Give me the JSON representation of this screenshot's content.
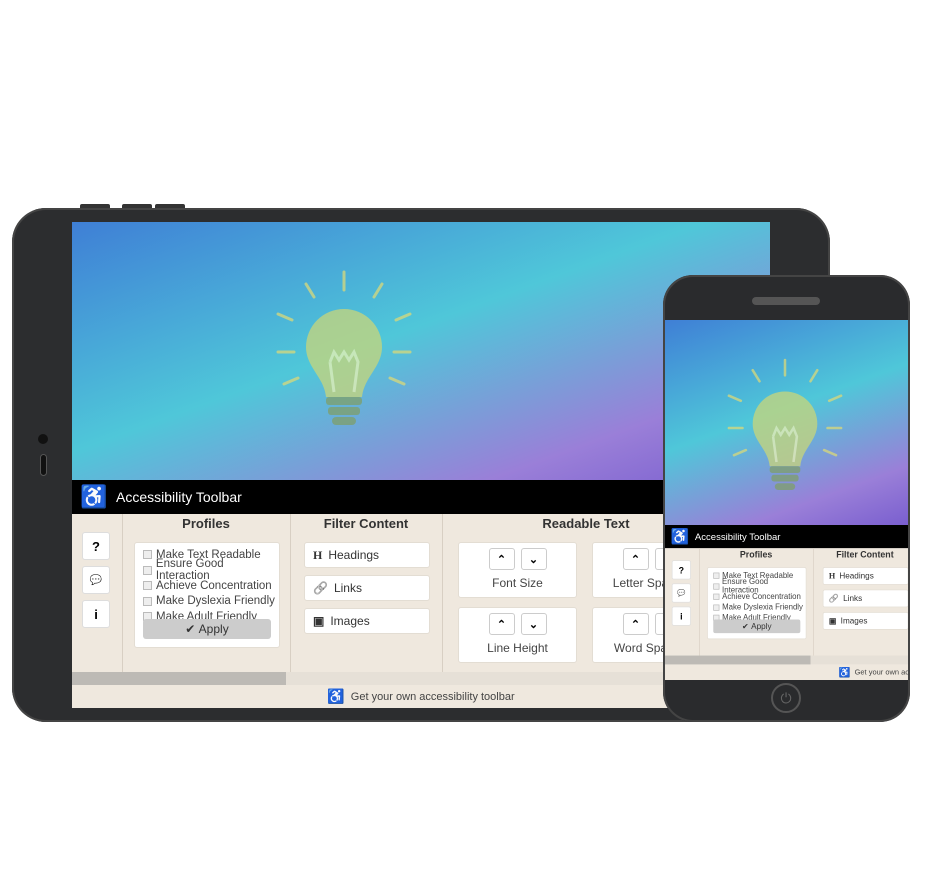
{
  "toolbar": {
    "title": "Accessibility Toolbar",
    "logo_icon": "accessibility-wheelchair-icon",
    "side_buttons": [
      {
        "icon": "help-icon",
        "glyph": "?"
      },
      {
        "icon": "feedback-icon",
        "glyph": "💬"
      },
      {
        "icon": "info-icon",
        "glyph": "i"
      }
    ],
    "sections": {
      "profiles": "Profiles",
      "filter": "Filter Content",
      "readable": "Readable Text"
    },
    "profiles": [
      "Make Text Readable",
      "Ensure Good Interaction",
      "Achieve Concentration",
      "Make Dyslexia Friendly",
      "Make Adult Friendly"
    ],
    "apply_label": "Apply",
    "filters": [
      {
        "label": "Headings",
        "icon": "heading-icon",
        "glyph": "H"
      },
      {
        "label": "Links",
        "icon": "link-icon",
        "glyph": "🔗"
      },
      {
        "label": "Images",
        "icon": "images-icon",
        "glyph": "▣"
      }
    ],
    "readable": [
      "Font Size",
      "Letter Spacing",
      "Line Height",
      "Word Spacing"
    ],
    "footer": "Get your own accessibility toolbar"
  },
  "colors": {
    "accent": "#e9622a",
    "header": "#000000",
    "panel": "#efe8de"
  }
}
